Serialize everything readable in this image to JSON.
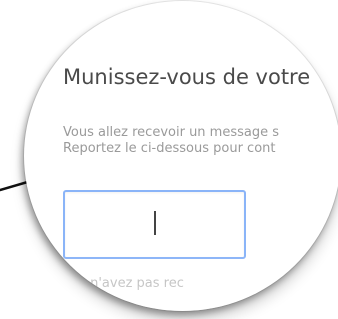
{
  "zoom": {
    "title": "Munissez-vous de votre",
    "body_lines": [
      "Vous allez recevoir un message s",
      "Reportez le ci-dessous pour cont"
    ],
    "input": {
      "value": "",
      "placeholder": ""
    },
    "footer_text": "ous n'avez pas rec"
  },
  "colors": {
    "accent": "#8ab4f8",
    "title_text": "#4a4a4a",
    "body_text": "#9a9a9a"
  }
}
